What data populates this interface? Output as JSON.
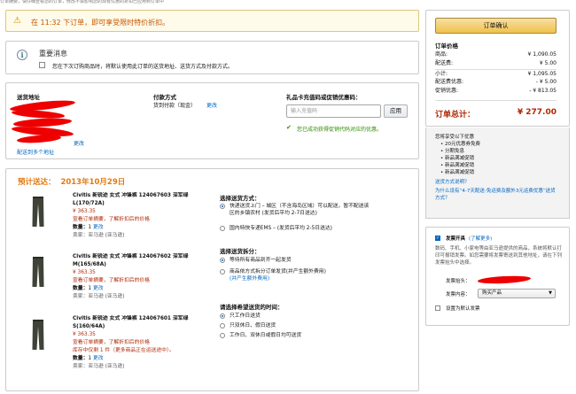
{
  "top_strip": "订单摘要，请仔细查看您的订单，修改不会影响您的现有优惠的折扣已应用到订单中",
  "alert": {
    "icon": "warning-icon",
    "message": "在 11:32 下订单，即可享受限时特价折扣。"
  },
  "notice": {
    "icon": "info-icon",
    "title": "重要消息",
    "checkbox_label": "您在下次订购商品时，将默认使用此订单的送货地址、送货方式及付款方式。"
  },
  "shipping_address": {
    "heading": "送货地址",
    "change": "更改",
    "add_link": "配送到多个地址"
  },
  "payment": {
    "heading": "付款方式",
    "method": "货到付款（现金）",
    "change": "更改"
  },
  "giftcard": {
    "heading": "礼品卡充值码或促销优惠码：",
    "placeholder": "输入充值码",
    "button": "应用",
    "success": "您已成功获得促销代码对应的优惠。"
  },
  "delivery": {
    "estimate_label": "预计送达：",
    "estimate_date": "2013年10月29日"
  },
  "products": [
    {
      "title": "Civitis 新锐迹 女式 冲锋裤 124067603 深军绿 L(170/72A)",
      "price": "¥ 363.35",
      "promo": "宣看订单摘要，了解折扣后的价格",
      "qty_label": "数量：",
      "qty": "1",
      "change": "更改",
      "seller": "卖家：亚马逊 (亚马逊)",
      "stock": ""
    },
    {
      "title": "Civitis 新锐迹 女式 冲锋裤 124067602 深军绿 M(165/68A)",
      "price": "¥ 363.35",
      "promo": "宣看订单摘要，了解折扣后的价格",
      "qty_label": "数量：",
      "qty": "1",
      "change": "更改",
      "seller": "卖家：亚马逊 (亚马逊)",
      "stock": ""
    },
    {
      "title": "Civitis 新锐迹 女式 冲锋裤 124067601 深军绿 S(160/64A)",
      "price": "¥ 363.35",
      "promo": "宣看订单摘要，了解折扣后的价格",
      "qty_label": "数量：",
      "qty": "1",
      "change": "更改",
      "seller": "卖家：亚马逊 (亚马逊)",
      "stock": "库存中仅剩 1 件（更多商品正在运送途中）。"
    }
  ],
  "ship_method": {
    "heading": "选择送货方式：",
    "options": [
      {
        "label": "快递送货上门 – 城区（不含海岛区域）可以配送，暂不配送该区的乡镇农村 (发货后平均 2-7日送达)",
        "line1": "快递送货上门 – 城区（不含海岛区域）可以配送，暂不配送该",
        "line2": "区的乡镇农村 (发货后平均 2-7日送达)",
        "selected": true
      },
      {
        "label": "国内特快专递EMS – (发货后平均 2-5日送达)",
        "selected": false
      }
    ]
  },
  "split": {
    "heading": "选择送货拆分：",
    "options": [
      {
        "label": "等待所有商品到齐一起发货",
        "selected": true
      },
      {
        "label": "商品依方式拆分订单发货(并产生额外费用)",
        "line1": "商品依方式拆分订单发货(并产生额外费用)",
        "link": "(并产生额外费用)",
        "selected": false
      }
    ]
  },
  "time": {
    "heading": "请选择希望送货的时间：",
    "options": [
      {
        "label": "只工作日送货",
        "selected": true
      },
      {
        "label": "只双休日、假日送货",
        "selected": false
      },
      {
        "label": "工作日、双休日或假日均可送货",
        "selected": false
      }
    ]
  },
  "summary": {
    "button": "订单确认",
    "heading": "订单价格",
    "rows": [
      {
        "label": "商品:",
        "value": "¥ 1,090.05"
      },
      {
        "label": "配送费:",
        "value": "¥ 5.00"
      },
      {
        "label": "小计:",
        "value": "¥ 1,095.05"
      },
      {
        "label": "配送费优惠:",
        "value": "- ¥ 5.00"
      },
      {
        "label": "促销优惠:",
        "value": "- ¥ 813.05"
      }
    ],
    "total_label": "订单总计：",
    "total_value": "¥ 277.00"
  },
  "benefits": {
    "intro": "您将享受以下优惠",
    "items": [
      "20元优惠券免费",
      "分期免息",
      "新品满减促销",
      "新品满减促销",
      "新品满减促销"
    ],
    "link1": "送货方式说明？",
    "link2": "为什么设有“4-7天配送-免运费及额外3元运费优惠”送货方式？"
  },
  "invoice": {
    "toggle_label": "发票开具",
    "toggle_link": "(了解更多)",
    "desc": "数码、手机、小家电等由亚马逊提供的商品，系统将默认打印可报销发票。如您需要将发票寄送到其他地址，请在下列发票抬头中选择。",
    "title_label": "发票抬头：",
    "content_label": "发票内容：",
    "content_value": "购买产品",
    "save_label": "设置为默认发票"
  },
  "colors": {
    "accent": "#e47911",
    "price": "#b12704",
    "link": "#0066c0",
    "button": "#f0c14b"
  }
}
